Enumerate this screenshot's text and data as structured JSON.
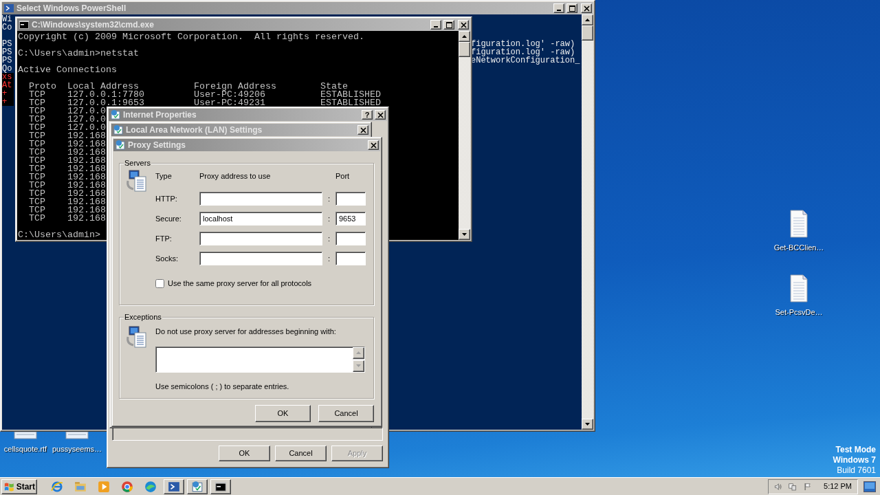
{
  "powershell_window": {
    "title": "Select Windows PowerShell",
    "blocks": [
      [
        {
          "kind": "output",
          "left": "Wi"
        },
        {
          "kind": "output",
          "left": "Co"
        }
      ],
      [
        {
          "kind": "output",
          "left": "PS",
          "right": "figuration.log' -raw)"
        },
        {
          "kind": "output",
          "left": "PS",
          "right": "figuration.log' -raw)"
        },
        {
          "kind": "output",
          "left": "PS",
          "right": "eNetworkConfiguration_"
        },
        {
          "kind": "output",
          "left": "Qo"
        },
        {
          "kind": "error",
          "left": "xs"
        },
        {
          "kind": "error",
          "left": "At"
        },
        {
          "kind": "error",
          "left": "+"
        },
        {
          "kind": "error",
          "left": "+"
        }
      ]
    ]
  },
  "cmd_window": {
    "title": "C:\\Windows\\system32\\cmd.exe",
    "blocks": [
      [
        "Copyright (c) 2009 Microsoft Corporation.  All rights reserved."
      ],
      [
        "C:\\Users\\admin>netstat"
      ],
      [
        "Active Connections"
      ],
      [
        "  Proto  Local Address          Foreign Address        State",
        "  TCP    127.0.0.1:7780         User-PC:49206          ESTABLISHED",
        "  TCP    127.0.0.1:9653         User-PC:49231          ESTABLISHED",
        "  TCP    127.0.0",
        "  TCP    127.0.0",
        "  TCP    127.0.0",
        "  TCP    192.168",
        "  TCP    192.168",
        "  TCP    192.168",
        "  TCP    192.168",
        "  TCP    192.168",
        "  TCP    192.168",
        "  TCP    192.168",
        "  TCP    192.168",
        "  TCP    192.168",
        "  TCP    192.168",
        "  TCP    192.168"
      ],
      [
        "C:\\Users\\admin>"
      ]
    ]
  },
  "internet_properties": {
    "title": "Internet Properties",
    "help": "?",
    "buttons": [
      {
        "label": "OK",
        "disabled": false
      },
      {
        "label": "Cancel",
        "disabled": false
      },
      {
        "label": "Apply",
        "disabled": true
      }
    ]
  },
  "lan_settings": {
    "title": "Local Area Network (LAN) Settings"
  },
  "proxy_settings": {
    "title": "Proxy Settings",
    "servers": {
      "legend": "Servers",
      "headers": {
        "type": "Type",
        "address": "Proxy address to use",
        "port": "Port"
      },
      "rows": [
        {
          "label": "HTTP:",
          "separator": ":"
        },
        {
          "label": "Secure:",
          "address": "localhost",
          "separator": ":",
          "port": "9653"
        },
        {
          "label": "FTP:",
          "separator": ":"
        },
        {
          "label": "Socks:",
          "separator": ":"
        }
      ],
      "same_proxy": {
        "label": "Use the same proxy server for all protocols",
        "checked": false
      }
    },
    "exceptions": {
      "legend": "Exceptions",
      "instruction": "Do not use proxy server for addresses beginning with:",
      "hint": "Use semicolons ( ; ) to separate entries."
    },
    "buttons": [
      {
        "label": "OK"
      },
      {
        "label": "Cancel"
      }
    ]
  },
  "desktop": {
    "left_icons": [
      {
        "label": "cellsquote.rtf"
      },
      {
        "label": "pussyseems…"
      }
    ],
    "right_icons": [
      {
        "label": "Get-BCClien…"
      },
      {
        "label": "Set-PcsvDe…"
      }
    ],
    "notice": [
      {
        "text": "Test Mode",
        "bold": true
      },
      {
        "text": "Windows 7",
        "bold": true
      },
      {
        "text": "Build 7601",
        "bold": false
      }
    ]
  },
  "taskbar": {
    "start": "Start",
    "apps": [
      {
        "kind": "ie",
        "open": false
      },
      {
        "kind": "folder",
        "open": false
      },
      {
        "kind": "media",
        "open": false
      },
      {
        "kind": "chrome",
        "open": false
      },
      {
        "kind": "edge",
        "open": false
      },
      {
        "kind": "powershell",
        "open": true
      },
      {
        "kind": "inetcpl",
        "open": true
      },
      {
        "kind": "cmd",
        "open": true
      }
    ],
    "clock": "5:12 PM"
  }
}
